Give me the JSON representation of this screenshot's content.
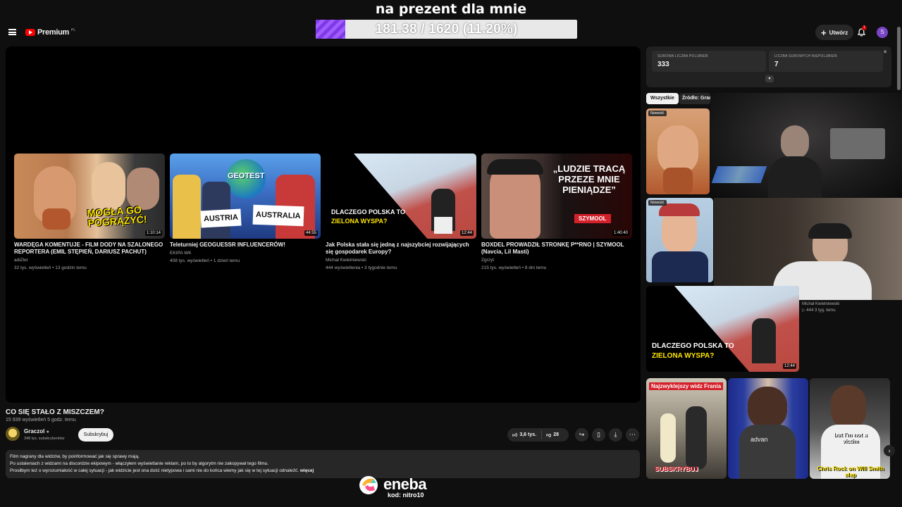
{
  "overlay": {
    "title": "na prezent dla mnie",
    "progress_text": "181.38 / 1620 (11.20%)",
    "progress_fraction": 0.112
  },
  "header": {
    "logo_text": "Premium",
    "country": "PL",
    "create_label": "Utwórz",
    "notifications_count": "1",
    "avatar_letter": "S"
  },
  "endcards": [
    {
      "title": "WARDĘGA KOMENTUJE - FILM DODY NA SZALONEGO REPORTERA (EMIL STĘPIEŃ, DARIUSZ PACHUT)",
      "channel": "adiZler",
      "meta": "32 tys. wyświetleń • 13 godzin temu",
      "duration": "1:10:14",
      "thumb_text": "MOGŁA GO POGRĄŻYĆ!"
    },
    {
      "title": "Teleturniej GEOGUESSR INFLUENCERÓW!",
      "channel": "EKIPA WK",
      "meta": "408 tys. wyświetleń • 1 dzień temu",
      "duration": "44:55",
      "thumb_text_1": "GEOTEST",
      "thumb_text_2": "AUSTRIA",
      "thumb_text_3": "AUSTRALIA"
    },
    {
      "title": "Jak Polska stała się jedną z najszybciej rozwijających się gospodarek Europy?",
      "channel": "Michał Kwietniewski",
      "meta": "444 wyświetlenia • 3 tygodnie temu",
      "duration": "12:44",
      "thumb_text_1": "DLACZEGO POLSKA TO",
      "thumb_text_2": "ZIELONA WYSPA?"
    },
    {
      "title": "BOXDEL PROWADZIŁ STRONKĘ P**RNO | SZYMOOL (Navcia, Lil Masti)",
      "channel": "Zgrzyt",
      "meta": "215 tys. wyświetleń • 8 dni temu",
      "duration": "1:40:40",
      "thumb_text": "„LUDZIE TRACĄ PRZEZE MNIE PIENIĄDZE”",
      "thumb_tag": "SZYMOOL"
    }
  ],
  "video": {
    "title": "CO SIĘ STAŁO Z MISZCZEM?",
    "views": "15 939 wyświetleń  5 godz. temu",
    "channel": "Graczol",
    "subs": "348 tys. subskrybentów",
    "subscribe_label": "Subskrybuj",
    "likes": "3,6 tys.",
    "dislikes": "28",
    "description_lines": [
      "Film nagrany dla widzów, by poinformować jak się sprawy mają.",
      "Po ustaleniach z widzami na discordzie ekipowym - włączyłem wyświetlanie reklam, po to by algorytm nie zakopywał tego filmu.",
      "Prosiłbym też o wyrozumiałość w całej sytuacji - jak widzicie jest ona dość nietypowa i sami nie do końca wiemy jak się w tej sytuacji odnaleźć."
    ],
    "more_label": "więcej"
  },
  "stats": {
    "likes_label": "SUROWA LICZBA POLUBIEŃ",
    "likes_value": "333",
    "dislikes_label": "LICZBA SUROWYCH NIEPOLUBIEŃ",
    "dislikes_value": "7"
  },
  "chips": {
    "all": "Wszystkie",
    "source": "Źródło: Graczol"
  },
  "related": {
    "new_label": "Nowość",
    "item3_channel": "Michał Kwietniewski",
    "item3_meta": "444  3 tyg. temu"
  },
  "shorts": [
    {
      "top_text": "Najzwyklejszy widz Frania",
      "bottom_text": "SUBSKRYBUJ"
    },
    {
      "top_text": "",
      "bottom_text": "advan"
    },
    {
      "top_text": "",
      "bottom_text_1": "but I'm not a victim",
      "bottom_text_2": "Chris Rock on Will Smith slap"
    }
  ],
  "sponsor": {
    "brand": "eneba",
    "code": "kod: nitro10"
  }
}
